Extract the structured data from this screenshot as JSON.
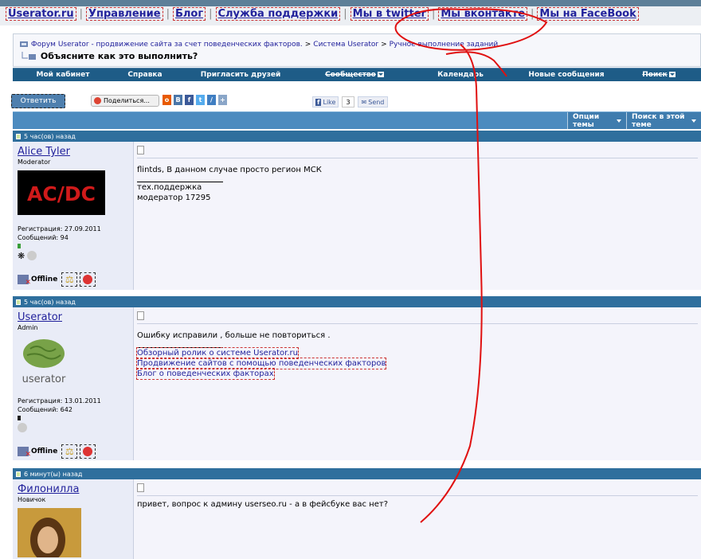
{
  "top_links": [
    "Userator.ru",
    "Управление",
    "Блог",
    "Служба поддержки",
    "Мы в twitter",
    "Мы вконтакте",
    "Мы на FaceBook"
  ],
  "breadcrumb": {
    "forum": "Форум Userator - продвижение сайта за счет поведенческих факторов.",
    "system": "Система Userator",
    "section": "Ручное выполнение заданий",
    "thread_title": "Объясните как это выполнить?"
  },
  "navbar": [
    "Мой кабинет",
    "Справка",
    "Пригласить друзей",
    "Сообщество",
    "Календарь",
    "Новые сообщения",
    "Поиск"
  ],
  "toolbar": {
    "reply": "Ответить",
    "share": "Поделиться...",
    "fb_like": "Like",
    "fb_count": "3",
    "fb_send": "Send"
  },
  "options": {
    "thread_options": "Опции темы",
    "search_thread": "Поиск в этой теме"
  },
  "posts": [
    {
      "time": "5 час(ов) назад",
      "author": "Alice Tyler",
      "role": "Moderator",
      "registered": "Регистрация: 27.09.2011",
      "messages": "Сообщений: 94",
      "status": "Offline",
      "lines": [
        "flintds, В данном случае просто регион МСК"
      ],
      "sig": [
        "тех.поддержка",
        "модератор 17295"
      ]
    },
    {
      "time": "5 час(ов) назад",
      "author": "Userator",
      "role": "Admin",
      "registered": "Регистрация: 13.01.2011",
      "messages": "Сообщений: 642",
      "status": "Offline",
      "lines": [
        "Ошибку исправили , больше не повториться ."
      ],
      "sig_links": [
        "Обзорный ролик о системе Userator.ru",
        "Продвижение сайтов с помощью поведенческих факторов",
        "Блог о поведенческих факторах"
      ]
    },
    {
      "time": "6 минут(ы) назад",
      "author": "Филонилла",
      "role": "Новичок",
      "lines": [
        "привет, вопрос к админу userseo.ru - а в фейсбуке вас нет?"
      ]
    }
  ],
  "avatars": {
    "post1": "AC/DC",
    "post2": "userator"
  },
  "colors": {
    "nav": "#1e5c87",
    "post_header": "#2f6f9d",
    "annotation": "#e01010"
  }
}
